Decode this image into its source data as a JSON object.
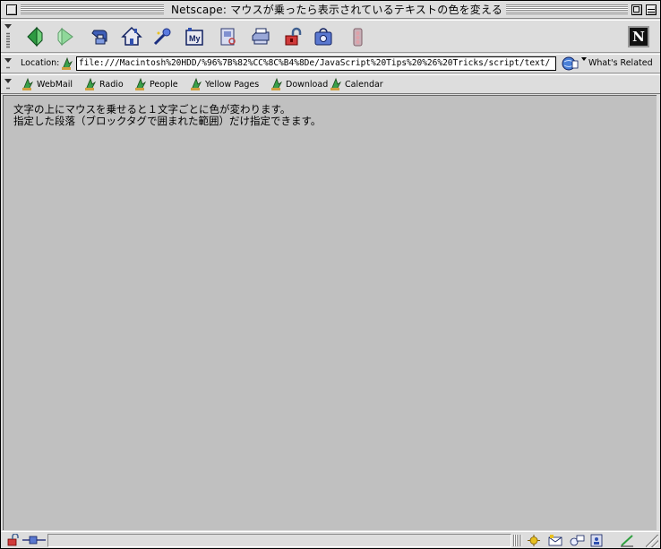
{
  "window": {
    "title": "Netscape: マウスが乗ったら表示されているテキストの色を変える"
  },
  "toolbar": {
    "buttons": [
      {
        "name": "back-button",
        "icon": "back-arrow-icon"
      },
      {
        "name": "forward-button",
        "icon": "forward-arrow-icon"
      },
      {
        "name": "reload-button",
        "icon": "reload-icon"
      },
      {
        "name": "home-button",
        "icon": "home-icon"
      },
      {
        "name": "search-button",
        "icon": "search-icon"
      },
      {
        "name": "my-netscape-button",
        "icon": "my-netscape-icon"
      },
      {
        "name": "images-button",
        "icon": "images-icon"
      },
      {
        "name": "print-button",
        "icon": "print-icon"
      },
      {
        "name": "security-button",
        "icon": "security-lock-icon"
      },
      {
        "name": "shop-button",
        "icon": "shop-icon"
      },
      {
        "name": "stop-button",
        "icon": "stop-icon"
      }
    ],
    "my_label": "My"
  },
  "location": {
    "label": "Location:",
    "url": "file:///Macintosh%20HDD/%96%7B%82%CC%8C%B4%8De/JavaScript%20Tips%20%26%20Tricks/script/text/",
    "related_label": "What's Related"
  },
  "personal_toolbar": {
    "items": [
      {
        "label": "WebMail"
      },
      {
        "label": "Radio"
      },
      {
        "label": "People"
      },
      {
        "label": "Yellow Pages"
      },
      {
        "label": "Download"
      },
      {
        "label": "Calendar"
      }
    ]
  },
  "content": {
    "line1": "文字の上にマウスを乗せると１文字ごとに色が変わります。",
    "line2": "指定した段落（ブロックタグで囲まれた範囲）だけ指定できます。"
  },
  "colors": {
    "window_bg": "#dddddd",
    "content_bg": "#c0c0c0",
    "accent_green": "#3aa04a",
    "accent_blue": "#2a4aa8"
  }
}
